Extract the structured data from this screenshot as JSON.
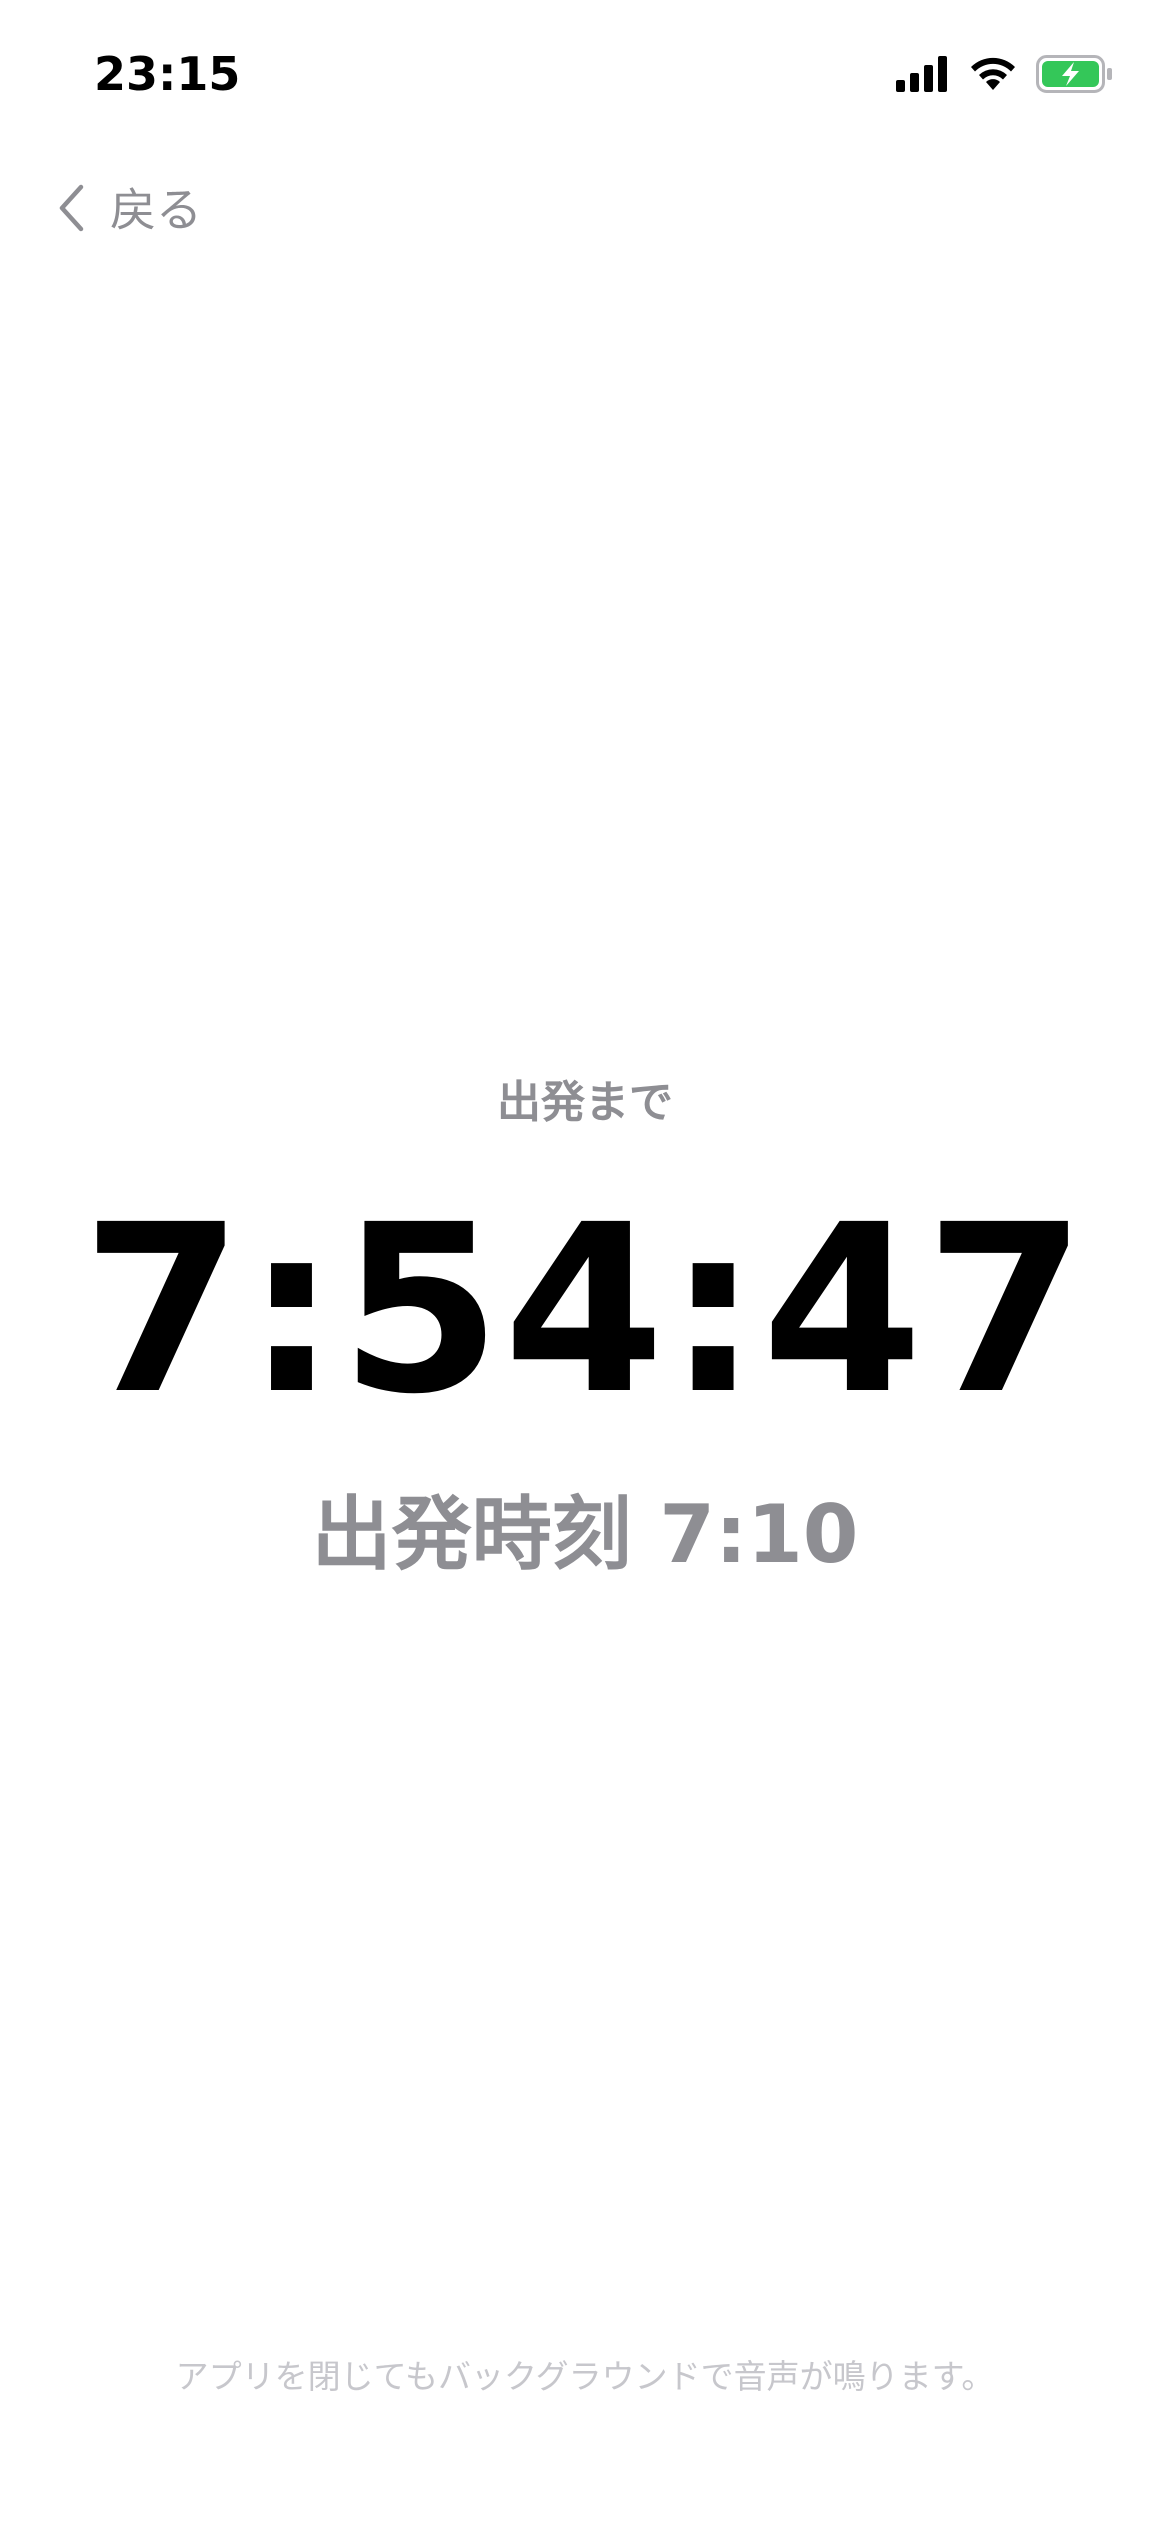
{
  "status_bar": {
    "time": "23:15",
    "icons": [
      "cellular-signal-icon",
      "wifi-icon",
      "battery-charging-icon"
    ],
    "battery_color": "#34c759"
  },
  "nav": {
    "back_icon": "chevron-left-icon",
    "back_label": "戻る"
  },
  "countdown": {
    "caption": "出発まで",
    "value": "7:54:47",
    "departure_label": "出発時刻 7:10"
  },
  "footer": {
    "note": "アプリを閉じてもバックグラウンドで音声が鳴ります。"
  },
  "colors": {
    "text_primary": "#000000",
    "text_secondary": "#8e8e93",
    "text_tertiary": "#c7c7cc",
    "background": "#ffffff"
  }
}
